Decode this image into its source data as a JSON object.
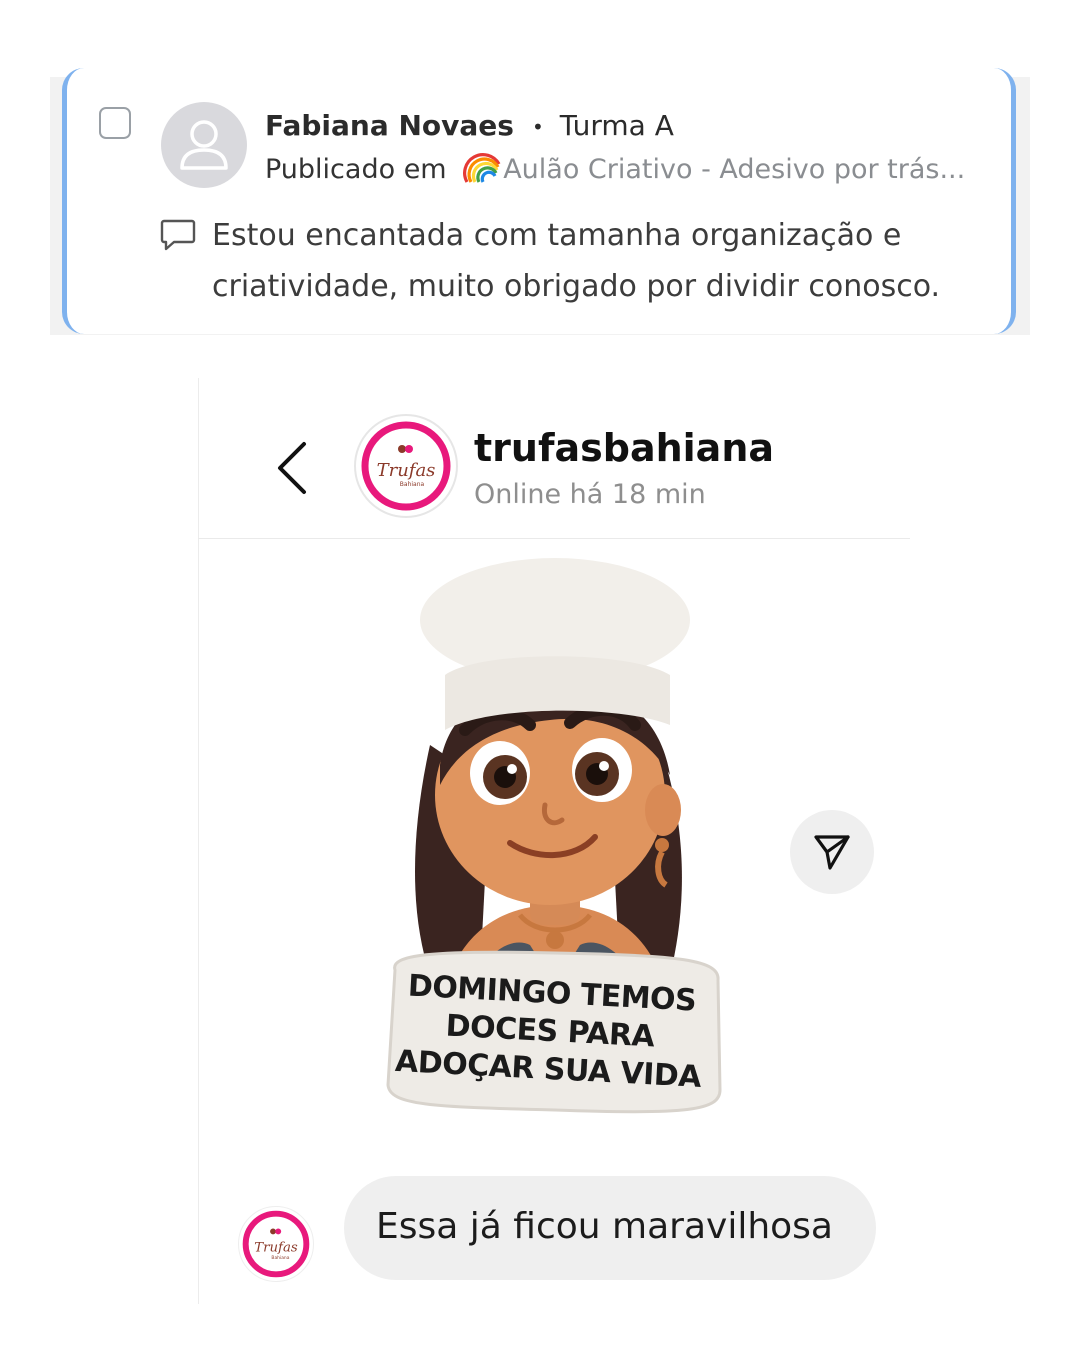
{
  "comment_card": {
    "author": "Fabiana Novaes",
    "separator": "•",
    "group": "Turma A",
    "published_prefix": "Publicado em",
    "published_link": "Aulão Criativo - Adesivo por trás...",
    "comment": "Estou encantada com tamanha organização e criatividade, muito obrigado por dividir conosco.",
    "accent_color": "#7fb2ee"
  },
  "dm": {
    "username": "trufasbahiana",
    "status": "Online há 18 min",
    "logo_text": "Trufas",
    "logo_subtext": "Bahiana",
    "sticker_text": "DOMINGO TEMOS DOCES PARA ADOÇAR SUA VIDA",
    "message": "Essa já ficou maravilhosa",
    "brand_color": "#e8197c"
  },
  "icons": {
    "back": "chevron-left-icon",
    "share": "paper-plane-icon",
    "comment": "speech-bubble-icon",
    "rainbow": "rainbow-icon",
    "avatar": "user-placeholder-icon"
  }
}
